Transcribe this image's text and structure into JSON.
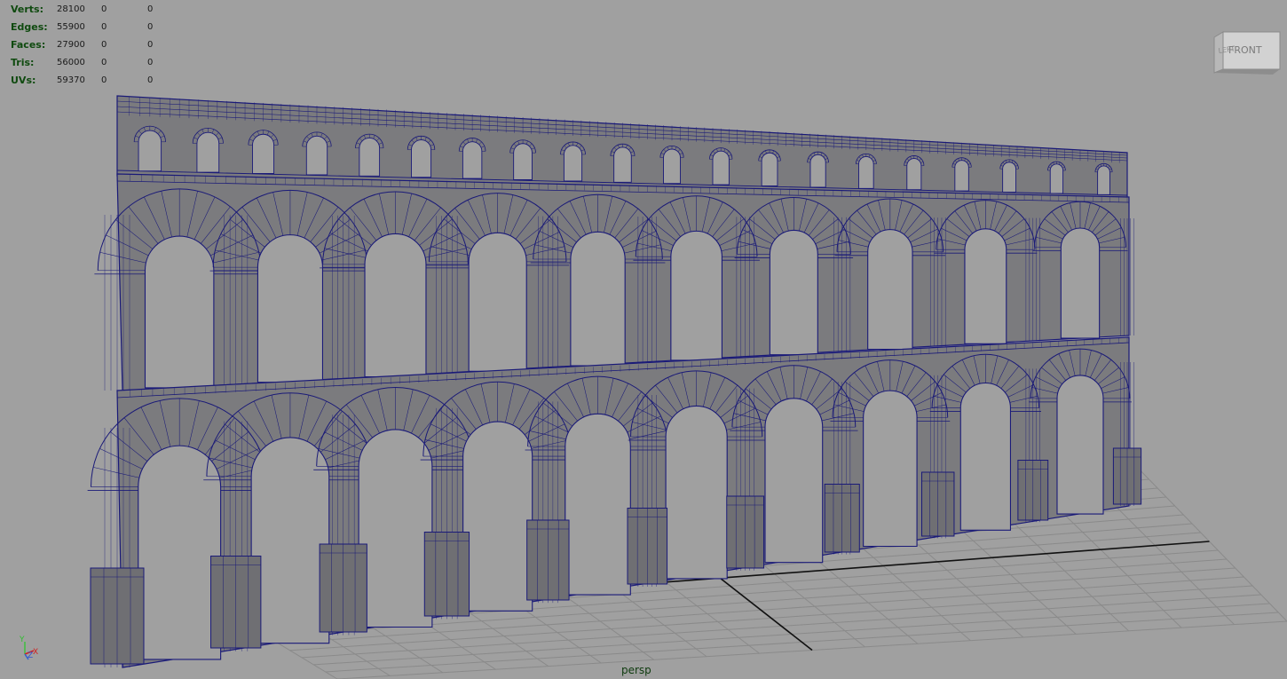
{
  "hud": {
    "rows": [
      {
        "label": "Verts:",
        "value": "28100",
        "sel": "0",
        "comp": "0"
      },
      {
        "label": "Edges:",
        "value": "55900",
        "sel": "0",
        "comp": "0"
      },
      {
        "label": "Faces:",
        "value": "27900",
        "sel": "0",
        "comp": "0"
      },
      {
        "label": "Tris:",
        "value": "56000",
        "sel": "0",
        "comp": "0"
      },
      {
        "label": "UVs:",
        "value": "59370",
        "sel": "0",
        "comp": "0"
      }
    ]
  },
  "view_cube": {
    "left_face": "LEFT",
    "front_face": "FRONT"
  },
  "axis_gizmo": {
    "y": "Y",
    "z": "Z",
    "x": "X"
  },
  "camera": {
    "label": "persp"
  },
  "scene": {
    "object": "aqueduct-mesh",
    "upper_tier_arches": 20,
    "middle_tier_arches": 10,
    "lower_tier_arches": 10,
    "colors": {
      "background": "#a0a0a0",
      "mesh_fill": "#7b7b7e",
      "wireframe": "#1a1a78",
      "grid": "#8a8a8a",
      "grid_axis": "#111111"
    }
  }
}
